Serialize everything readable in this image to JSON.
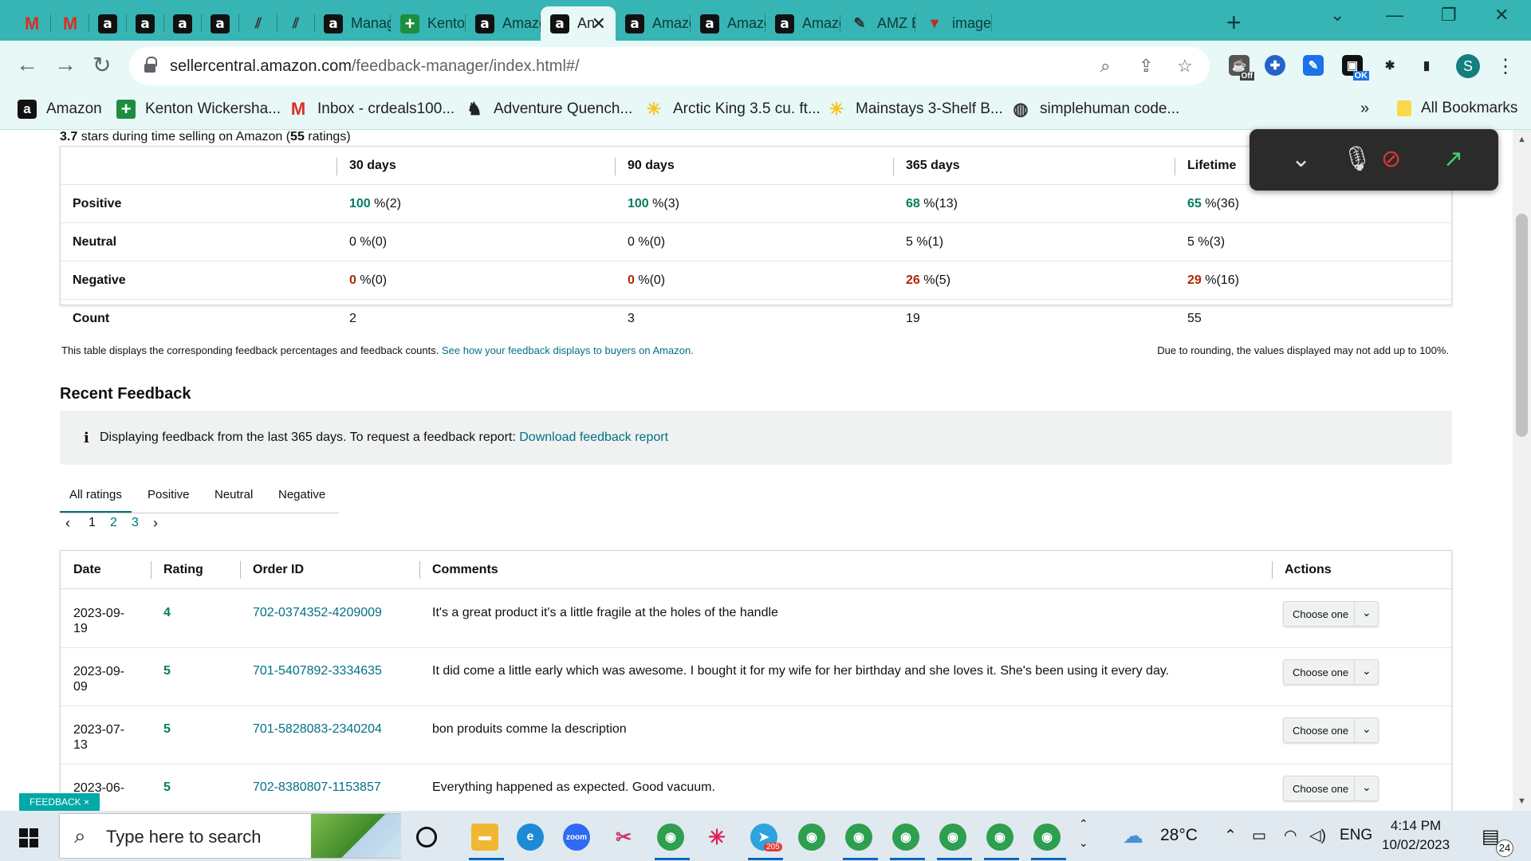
{
  "browser": {
    "tabs": [
      {
        "title": "",
        "icon": "gmail-icon"
      },
      {
        "title": "",
        "icon": "gmail-icon"
      },
      {
        "title": "",
        "icon": "amazon-icon"
      },
      {
        "title": "",
        "icon": "amazon-icon"
      },
      {
        "title": "",
        "icon": "amazon-icon"
      },
      {
        "title": "",
        "icon": "amazon-icon"
      },
      {
        "title": "",
        "icon": "stripes-icon"
      },
      {
        "title": "",
        "icon": "stripes-icon"
      },
      {
        "title": "Manag",
        "icon": "amazon-icon"
      },
      {
        "title": "Kenton",
        "icon": "plus-icon"
      },
      {
        "title": "Amazo",
        "icon": "amazon-icon"
      },
      {
        "title": "An",
        "icon": "amazon-icon",
        "active": true
      },
      {
        "title": "Amazo",
        "icon": "amazon-icon"
      },
      {
        "title": "Amazo",
        "icon": "amazon-icon"
      },
      {
        "title": "Amazo",
        "icon": "amazon-icon"
      },
      {
        "title": "AMZ E",
        "icon": "pen-icon"
      },
      {
        "title": "image",
        "icon": "shield-icon"
      }
    ],
    "url_domain": "sellercentral.amazon.com",
    "url_path": "/feedback-manager/index.html#/",
    "extensions": {
      "off_badge": "Off",
      "ok_badge": "OK"
    },
    "profile_initial": "S",
    "bookmarks": [
      {
        "label": "Amazon",
        "icon": "amazon-icon"
      },
      {
        "label": "Kenton Wickersha...",
        "icon": "plus-icon"
      },
      {
        "label": "Inbox - crdeals100...",
        "icon": "gmail-icon"
      },
      {
        "label": "Adventure Quench...",
        "icon": "bull-icon"
      },
      {
        "label": "Arctic King 3.5 cu. ft...",
        "icon": "spark-icon"
      },
      {
        "label": "Mainstays 3-Shelf B...",
        "icon": "spark-icon"
      },
      {
        "label": "simplehuman code...",
        "icon": "globe-icon"
      }
    ],
    "bookmarks_overflow": "»",
    "all_bookmarks": "All Bookmarks"
  },
  "feedback_summary": {
    "rating_value": "3.7",
    "rating_text": " stars during time selling on Amazon (",
    "rating_count": "55",
    "rating_suffix": " ratings)",
    "headers": [
      "",
      "30 days",
      "90 days",
      "365 days",
      "Lifetime"
    ],
    "rows": [
      {
        "label": "Positive",
        "cells": [
          {
            "pct": "100",
            "rest": " %(2)",
            "tone": "pos"
          },
          {
            "pct": "100",
            "rest": " %(3)",
            "tone": "pos"
          },
          {
            "pct": "68",
            "rest": " %(13)",
            "tone": "pos"
          },
          {
            "pct": "65",
            "rest": " %(36)",
            "tone": "pos"
          }
        ]
      },
      {
        "label": "Neutral",
        "cells": [
          {
            "pct": "0",
            "rest": " %(0)",
            "tone": "neu"
          },
          {
            "pct": "0",
            "rest": " %(0)",
            "tone": "neu"
          },
          {
            "pct": "5",
            "rest": " %(1)",
            "tone": "neu"
          },
          {
            "pct": "5",
            "rest": " %(3)",
            "tone": "neu"
          }
        ]
      },
      {
        "label": "Negative",
        "cells": [
          {
            "pct": "0",
            "rest": " %(0)",
            "tone": "neg"
          },
          {
            "pct": "0",
            "rest": " %(0)",
            "tone": "neg"
          },
          {
            "pct": "26",
            "rest": " %(5)",
            "tone": "neg"
          },
          {
            "pct": "29",
            "rest": " %(16)",
            "tone": "neg"
          }
        ]
      },
      {
        "label": "Count",
        "cells": [
          {
            "pct": "",
            "rest": "2",
            "tone": "neu"
          },
          {
            "pct": "",
            "rest": "3",
            "tone": "neu"
          },
          {
            "pct": "",
            "rest": "19",
            "tone": "neu"
          },
          {
            "pct": "",
            "rest": "55",
            "tone": "neu"
          }
        ]
      }
    ],
    "note": "This table displays the corresponding feedback percentages and feedback counts. ",
    "note_link": "See how your feedback displays to buyers on Amazon.",
    "rounding_note": "Due to rounding, the values displayed may not add up to 100%."
  },
  "recent": {
    "title": "Recent Feedback",
    "info_icon": "i",
    "info_text": "Displaying feedback from the last 365 days. To request a feedback report: ",
    "info_link": "Download feedback report",
    "tabs": [
      "All ratings",
      "Positive",
      "Neutral",
      "Negative"
    ],
    "pager": {
      "prev": "‹",
      "pages": [
        "1",
        "2",
        "3"
      ],
      "next": "›"
    },
    "columns": [
      "Date",
      "Rating",
      "Order ID",
      "Comments",
      "Actions"
    ],
    "rows": [
      {
        "date": "2023-09-19",
        "rating": "4",
        "order_id": "702-0374352-4209009",
        "comment": "It's a great product it's a little fragile at the holes of the handle"
      },
      {
        "date": "2023-09-09",
        "rating": "5",
        "order_id": "701-5407892-3334635",
        "comment": "It did come a little early which was awesome. I bought it for my wife for her birthday and she loves it. She's been using it every day."
      },
      {
        "date": "2023-07-13",
        "rating": "5",
        "order_id": "701-5828083-2340204",
        "comment": "bon produits comme la description"
      },
      {
        "date": "2023-06-",
        "rating": "5",
        "order_id": "702-8380807-1153857",
        "comment": "Everything happened as expected. Good vacuum."
      }
    ],
    "action_label": "Choose one"
  },
  "feedback_tab": "FEEDBACK ×",
  "taskbar": {
    "search_placeholder": "Type here to search",
    "telegram_badge": "205",
    "temperature": "28°C",
    "language": "ENG",
    "time": "4:14 PM",
    "date": "10/02/2023",
    "notification_count": "24"
  },
  "colors": {
    "teal_frame": "#36b5b4",
    "positive": "#067d62",
    "negative": "#b12704",
    "link": "#007185"
  }
}
